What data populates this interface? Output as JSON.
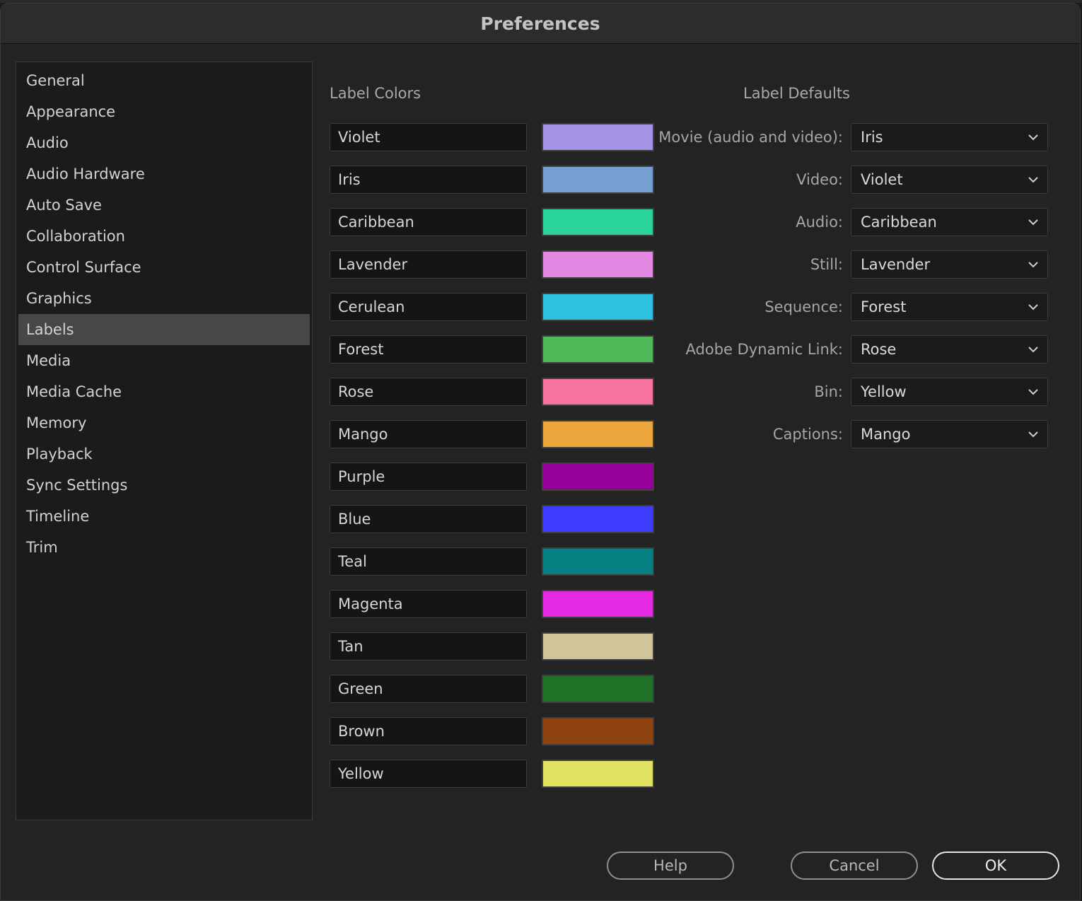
{
  "window": {
    "title": "Preferences"
  },
  "sidebar": {
    "items": [
      {
        "label": "General"
      },
      {
        "label": "Appearance"
      },
      {
        "label": "Audio"
      },
      {
        "label": "Audio Hardware"
      },
      {
        "label": "Auto Save"
      },
      {
        "label": "Collaboration"
      },
      {
        "label": "Control Surface"
      },
      {
        "label": "Graphics"
      },
      {
        "label": "Labels",
        "selected": true
      },
      {
        "label": "Media"
      },
      {
        "label": "Media Cache"
      },
      {
        "label": "Memory"
      },
      {
        "label": "Playback"
      },
      {
        "label": "Sync Settings"
      },
      {
        "label": "Timeline"
      },
      {
        "label": "Trim"
      }
    ]
  },
  "label_colors": {
    "title": "Label Colors",
    "items": [
      {
        "name": "Violet",
        "color": "#a592e2"
      },
      {
        "name": "Iris",
        "color": "#769ed2"
      },
      {
        "name": "Caribbean",
        "color": "#29d39b"
      },
      {
        "name": "Lavender",
        "color": "#e388e3"
      },
      {
        "name": "Cerulean",
        "color": "#2fbfe1"
      },
      {
        "name": "Forest",
        "color": "#51b859"
      },
      {
        "name": "Rose",
        "color": "#f6729f"
      },
      {
        "name": "Mango",
        "color": "#eba63c"
      },
      {
        "name": "Purple",
        "color": "#95009a"
      },
      {
        "name": "Blue",
        "color": "#3e3dfd"
      },
      {
        "name": "Teal",
        "color": "#078083"
      },
      {
        "name": "Magenta",
        "color": "#e528e1"
      },
      {
        "name": "Tan",
        "color": "#cfc49a"
      },
      {
        "name": "Green",
        "color": "#1f7127"
      },
      {
        "name": "Brown",
        "color": "#8f4410"
      },
      {
        "name": "Yellow",
        "color": "#e2e263"
      }
    ]
  },
  "label_defaults": {
    "title": "Label Defaults",
    "items": [
      {
        "label": "Movie (audio and video):",
        "value": "Iris"
      },
      {
        "label": "Video:",
        "value": "Violet"
      },
      {
        "label": "Audio:",
        "value": "Caribbean"
      },
      {
        "label": "Still:",
        "value": "Lavender"
      },
      {
        "label": "Sequence:",
        "value": "Forest"
      },
      {
        "label": "Adobe Dynamic Link:",
        "value": "Rose"
      },
      {
        "label": "Bin:",
        "value": "Yellow"
      },
      {
        "label": "Captions:",
        "value": "Mango"
      }
    ]
  },
  "footer": {
    "help_label": "Help",
    "cancel_label": "Cancel",
    "ok_label": "OK"
  }
}
